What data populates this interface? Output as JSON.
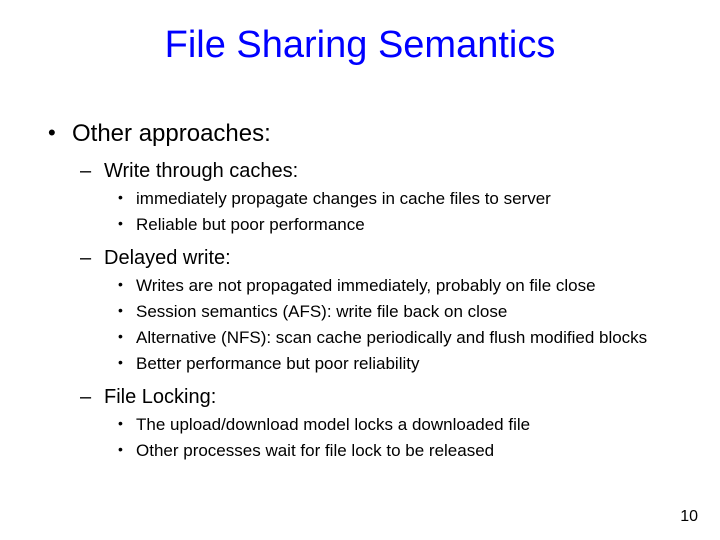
{
  "title": "File Sharing Semantics",
  "l1": "Other approaches:",
  "sections": [
    {
      "heading": "Write through caches:",
      "items": [
        "immediately propagate changes in cache files to server",
        "Reliable but poor performance"
      ]
    },
    {
      "heading": "Delayed write:",
      "items": [
        "Writes are not propagated immediately, probably on file close",
        "Session semantics (AFS): write file back on close",
        "Alternative (NFS): scan cache periodically and flush modified blocks",
        "Better performance but poor reliability"
      ]
    },
    {
      "heading": "File Locking:",
      "items": [
        "The upload/download model locks a downloaded file",
        "Other processes wait for file lock to be released"
      ]
    }
  ],
  "page_number": "10"
}
